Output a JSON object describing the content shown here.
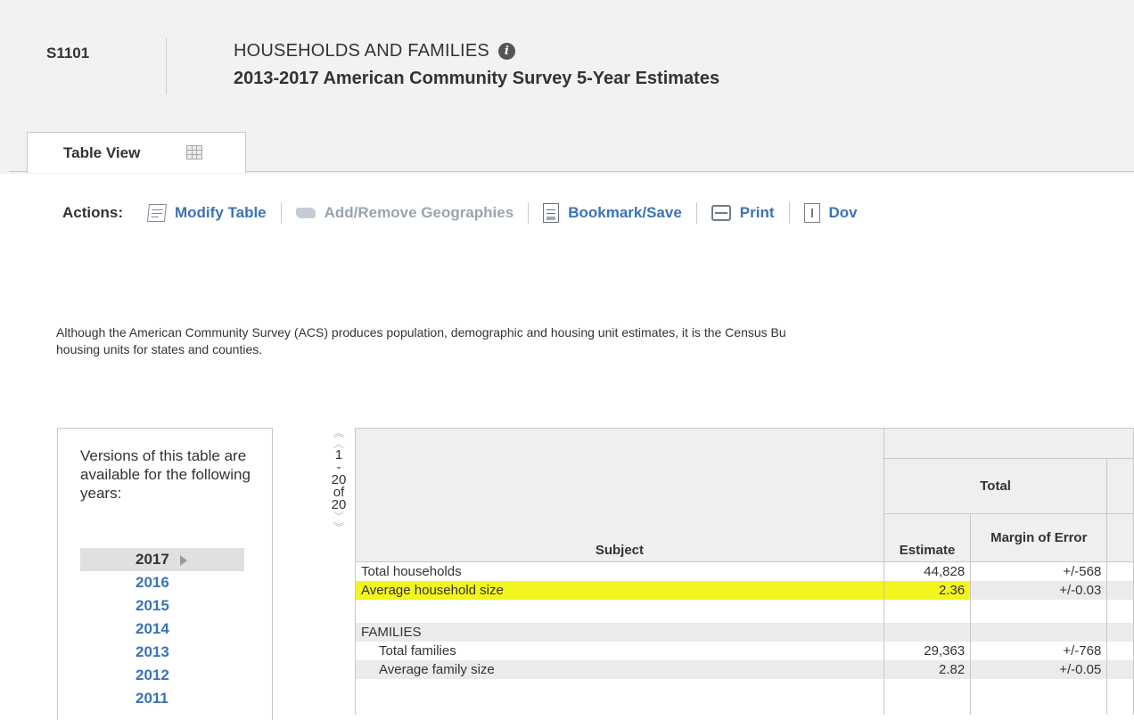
{
  "header": {
    "table_id": "S1101",
    "title": "HOUSEHOLDS AND FAMILIES",
    "info_icon_glyph": "i",
    "subtitle": "2013-2017 American Community Survey 5-Year Estimates"
  },
  "tabs": [
    {
      "label": "Table View",
      "icon": "grid-icon",
      "active": true
    }
  ],
  "actions": {
    "label": "Actions:",
    "items": [
      {
        "label": "Modify Table",
        "icon": "modify-table-icon",
        "enabled": true
      },
      {
        "label": "Add/Remove Geographies",
        "icon": "geography-icon",
        "enabled": false
      },
      {
        "label": "Bookmark/Save",
        "icon": "bookmark-icon",
        "enabled": true
      },
      {
        "label": "Print",
        "icon": "print-icon",
        "enabled": true
      },
      {
        "label": "Dov",
        "icon": "download-icon",
        "enabled": true
      }
    ]
  },
  "description": {
    "line1": "Although the American Community Survey (ACS) produces population, demographic and housing unit estimates, it is the Census Bu",
    "line2": "housing units for states and counties."
  },
  "versions": {
    "text": "Versions of this table are available for the following years:",
    "years": [
      "2017",
      "2016",
      "2015",
      "2014",
      "2013",
      "2012",
      "2011"
    ],
    "selected": "2017"
  },
  "pager": {
    "start": "1",
    "dash": "-",
    "end": "20",
    "of": "of",
    "total": "20"
  },
  "table": {
    "group_header": "Total",
    "columns": {
      "subject": "Subject",
      "estimate": "Estimate",
      "moe": "Margin of Error"
    },
    "rows": [
      {
        "subject": "Total households",
        "estimate": "44,828",
        "moe": "+/-568",
        "indent": false,
        "shade": false
      },
      {
        "subject": "Average household size",
        "estimate": "2.36",
        "moe": "+/-0.03",
        "indent": false,
        "shade": true,
        "highlighted": true
      },
      {
        "subject": "",
        "estimate": "",
        "moe": "",
        "indent": false,
        "shade": false
      },
      {
        "subject": "FAMILIES",
        "estimate": "",
        "moe": "",
        "indent": false,
        "shade": true
      },
      {
        "subject": "Total families",
        "estimate": "29,363",
        "moe": "+/-768",
        "indent": true,
        "shade": false
      },
      {
        "subject": "Average family size",
        "estimate": "2.82",
        "moe": "+/-0.05",
        "indent": true,
        "shade": true
      },
      {
        "subject": "",
        "estimate": "",
        "moe": "",
        "indent": false,
        "shade": false
      }
    ]
  },
  "colors": {
    "link": "#3b73b9",
    "highlight": "#f2f51e",
    "header_band": "#f2f2f2"
  }
}
